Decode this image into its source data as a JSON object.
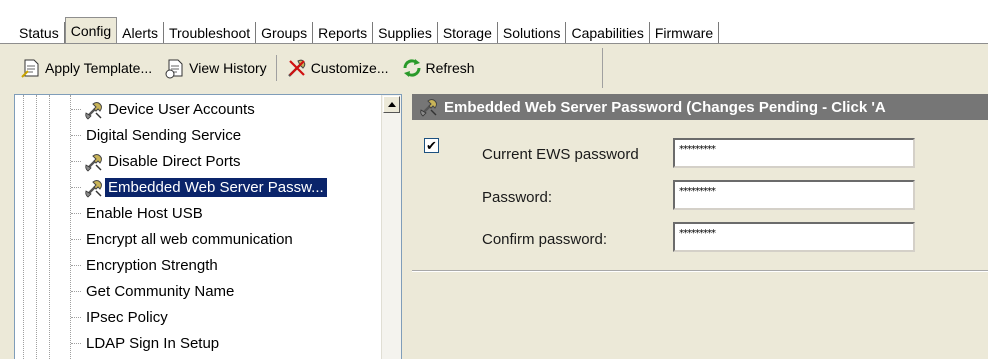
{
  "tabs": [
    "Status",
    "Config",
    "Alerts",
    "Troubleshoot",
    "Groups",
    "Reports",
    "Supplies",
    "Storage",
    "Solutions",
    "Capabilities",
    "Firmware"
  ],
  "active_tab": "Config",
  "toolbar": {
    "apply_template": "Apply Template...",
    "view_history": "View History",
    "customize": "Customize...",
    "refresh": "Refresh"
  },
  "tree": {
    "items": [
      {
        "label": "Device User Accounts",
        "icon": "wrench-icon",
        "selected": false
      },
      {
        "label": "Digital Sending Service",
        "icon": "",
        "selected": false
      },
      {
        "label": "Disable Direct Ports",
        "icon": "wrench-icon",
        "selected": false
      },
      {
        "label": "Embedded Web Server Passw...",
        "icon": "wrench-icon",
        "selected": true
      },
      {
        "label": "Enable Host USB",
        "icon": "",
        "selected": false
      },
      {
        "label": "Encrypt all web communication",
        "icon": "",
        "selected": false
      },
      {
        "label": "Encryption Strength",
        "icon": "",
        "selected": false
      },
      {
        "label": "Get Community Name",
        "icon": "",
        "selected": false
      },
      {
        "label": "IPsec Policy",
        "icon": "",
        "selected": false
      },
      {
        "label": "LDAP Sign In Setup",
        "icon": "",
        "selected": false
      }
    ]
  },
  "detail": {
    "header": "Embedded Web Server Password (Changes Pending - Click 'A",
    "enabled_checked": true,
    "fields": [
      {
        "label": "Current EWS password",
        "value": "*********"
      },
      {
        "label": "Password:",
        "value": "*********"
      },
      {
        "label": "Confirm password:",
        "value": "*********"
      }
    ]
  },
  "colors": {
    "selection": "#0a246a",
    "header_bg": "#767676",
    "window_bg": "#ece9d8"
  }
}
